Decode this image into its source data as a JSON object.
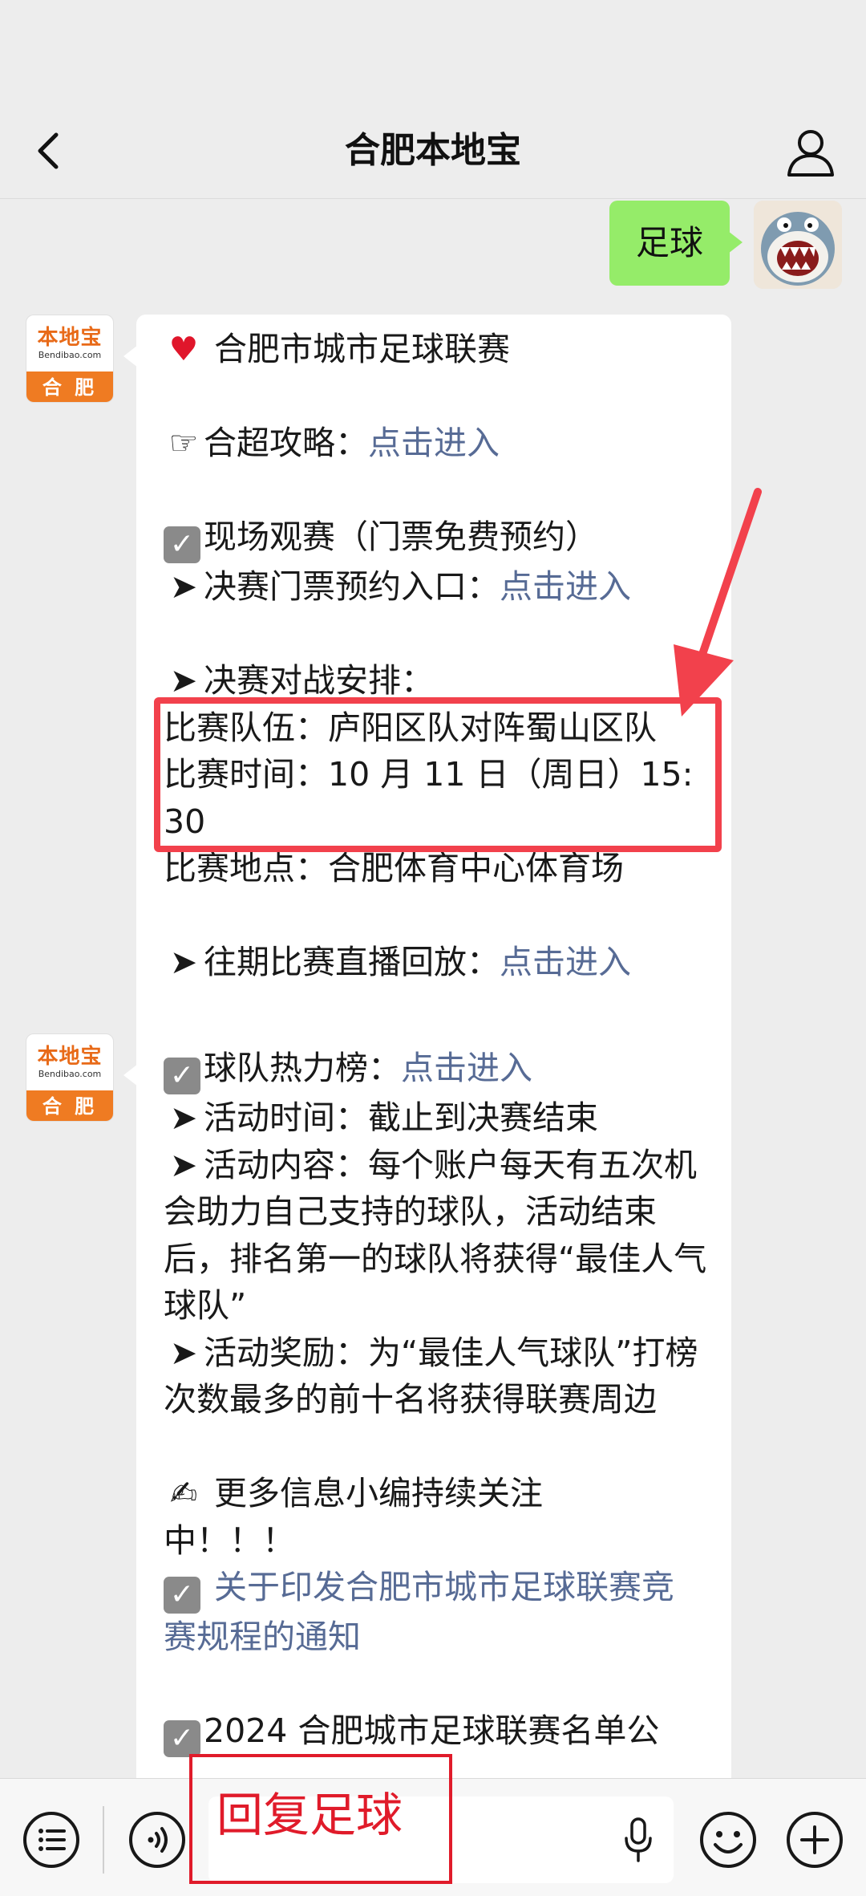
{
  "header": {
    "title": "合肥本地宝"
  },
  "outgoing_message": {
    "text": "足球"
  },
  "bot": {
    "logo_text": "本地宝",
    "logo_url": "Bendibao.com",
    "logo_city": "合 肥"
  },
  "message1": {
    "title": "合肥市城市足球联赛",
    "guide_label": "合超攻略：",
    "guide_link": "点击进入",
    "watch_label": "现场观赛（门票免费预约）",
    "ticket_label": "决赛门票预约入口：",
    "ticket_link": "点击进入",
    "final_label": "决赛对战安排：",
    "teams": "比赛队伍：庐阳区队对阵蜀山区队",
    "time_a": "比赛时间：10 月 11 日（周日）15:",
    "time_b": "30",
    "venue": "比赛地点：合肥体育中心体育场",
    "replay_label": "往期比赛直播回放：",
    "replay_link": "点击进入"
  },
  "message2": {
    "ranking_label": "球队热力榜：",
    "ranking_link": "点击进入",
    "activity_time": "活动时间：截止到决赛结束",
    "activity_content": "活动内容：每个账户每天有五次机会助力自己支持的球队，活动结束后，排名第一的球队将获得“最佳人气球队”",
    "activity_reward": "活动奖励：为“最佳人气球队”打榜次数最多的前十名将获得联赛周边",
    "more_info_a": "更多信息小编持续关注",
    "more_info_b": "中！！！",
    "notice_link": "关于印发合肥市城市足球联赛竞赛规程的通知",
    "partial_line": "2024 合肥城市足球联赛名单公"
  },
  "input_bar": {
    "overlay_text": "回复足球"
  }
}
